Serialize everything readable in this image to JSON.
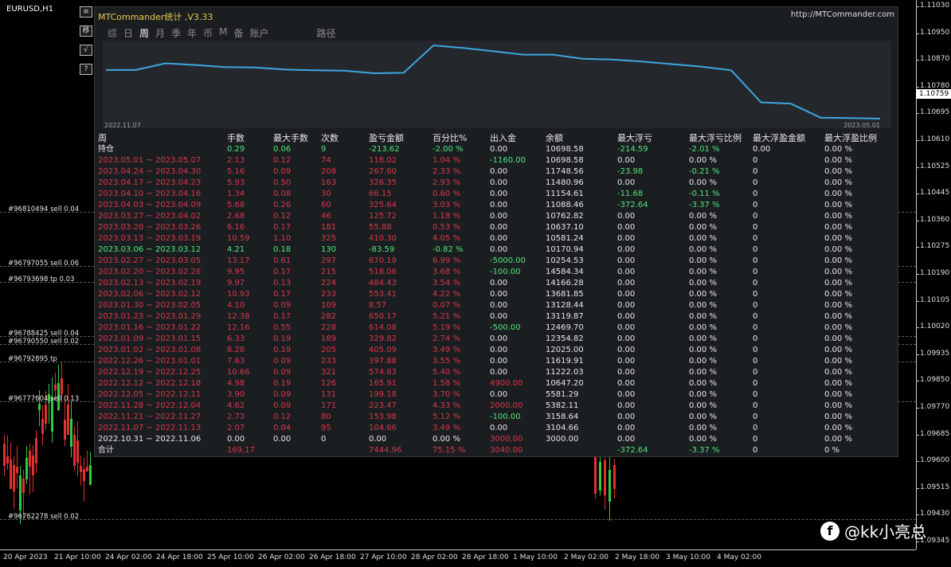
{
  "chart": {
    "title": "EURUSD,H1",
    "price_ticks": [
      "1.11030",
      "1.10950",
      "1.10870",
      "1.10780",
      "1.10695",
      "1.10610",
      "1.10525",
      "1.10445",
      "1.10360",
      "1.10275",
      "1.10190",
      "1.10105",
      "1.10020",
      "1.09935",
      "1.09850",
      "1.09770",
      "1.09685",
      "1.09600",
      "1.09515",
      "1.09430",
      "1.09345"
    ],
    "current_price": "1.10759",
    "time_ticks": [
      "20 Apr 2023",
      "21 Apr 10:00",
      "24 Apr 02:00",
      "24 Apr 18:00",
      "25 Apr 10:00",
      "26 Apr 02:00",
      "26 Apr 18:00",
      "27 Apr 10:00",
      "28 Apr 02:00",
      "28 Apr 18:00",
      "1 May 10:00",
      "2 May 02:00",
      "2 May 18:00",
      "3 May 10:00",
      "4 May 02:00"
    ],
    "order_labels": [
      "#96810494 sell 0.04",
      "#96797055 sell 0.06",
      "#96793698 tp 0.03",
      "#96788425 sell 0.04",
      "#96790550 sell 0.02",
      "#96792895 tp",
      "#96777604 sell 0.13",
      "#96762278 sell 0.02"
    ],
    "side_buttons": [
      "≡",
      "移",
      "√",
      "?"
    ]
  },
  "window": {
    "title": "MTCommander统计 ,V3.33",
    "url": "http://MTCommander.com",
    "tabs": [
      "综",
      "日",
      "周",
      "月",
      "季",
      "年",
      "币",
      "M",
      "备",
      "账户",
      "路径"
    ],
    "active_tab": "周",
    "equity_start": "2022.11.07",
    "equity_end": "2023.05.01",
    "equity_values": [
      3000,
      3104,
      3158,
      5382,
      5581,
      10647,
      11222,
      11620,
      12025,
      12354,
      12470,
      13120,
      13128,
      13682,
      14166,
      14584,
      10254,
      10171,
      10581,
      10637,
      10763,
      11088,
      11155,
      11481,
      11749,
      10699,
      10699
    ]
  },
  "colors": {
    "pos": "#4fe87a",
    "neg": "#d8364a",
    "neutral": "#e6e6e6",
    "accent": "#3ea6e0"
  },
  "table": {
    "headers": [
      "周",
      "手数",
      "最大手数",
      "次数",
      "盈亏金额",
      "百分比%",
      "出入金",
      "余额",
      "最大浮亏",
      "最大浮亏比例",
      "最大浮盈金额",
      "最大浮盈比例"
    ],
    "rows": [
      {
        "c": [
          "持仓",
          "0.29",
          "0.06",
          "9",
          "-213.62",
          "-2.00 %",
          "0.00",
          "10698.58",
          "-214.59",
          "-2.01 %",
          "0.00",
          "0.00 %"
        ],
        "k": [
          "w",
          "g",
          "g",
          "g",
          "g",
          "g",
          "w",
          "w",
          "g",
          "g",
          "w",
          "w"
        ]
      },
      {
        "c": [
          "2023.05.01 ~ 2023.05.07",
          "2.13",
          "0.12",
          "74",
          "118.02",
          "1.04 %",
          "-1160.00",
          "10698.58",
          "0.00",
          "0.00 %",
          "0",
          "0.00 %"
        ],
        "k": [
          "r",
          "r",
          "r",
          "r",
          "r",
          "r",
          "g",
          "w",
          "w",
          "w",
          "w",
          "w"
        ]
      },
      {
        "c": [
          "2023.04.24 ~ 2023.04.30",
          "5.16",
          "0.09",
          "208",
          "267.60",
          "2.33 %",
          "0.00",
          "11748.56",
          "-23.98",
          "-0.21 %",
          "0",
          "0.00 %"
        ],
        "k": [
          "r",
          "r",
          "r",
          "r",
          "r",
          "r",
          "w",
          "w",
          "g",
          "g",
          "w",
          "w"
        ]
      },
      {
        "c": [
          "2023.04.17 ~ 2023.04.23",
          "5.93",
          "0.50",
          "163",
          "326.35",
          "2.93 %",
          "0.00",
          "11480.96",
          "0.00",
          "0.00 %",
          "0",
          "0.00 %"
        ],
        "k": [
          "r",
          "r",
          "r",
          "r",
          "r",
          "r",
          "w",
          "w",
          "w",
          "w",
          "w",
          "w"
        ]
      },
      {
        "c": [
          "2023.04.10 ~ 2023.04.16",
          "1.34",
          "0.08",
          "30",
          "66.15",
          "0.60 %",
          "0.00",
          "11154.61",
          "-11.68",
          "-0.11 %",
          "0",
          "0.00 %"
        ],
        "k": [
          "r",
          "r",
          "r",
          "r",
          "r",
          "r",
          "w",
          "w",
          "g",
          "g",
          "w",
          "w"
        ]
      },
      {
        "c": [
          "2023.04.03 ~ 2023.04.09",
          "5.68",
          "0.26",
          "60",
          "325.64",
          "3.03 %",
          "0.00",
          "11088.46",
          "-372.64",
          "-3.37 %",
          "0",
          "0.00 %"
        ],
        "k": [
          "r",
          "r",
          "r",
          "r",
          "r",
          "r",
          "w",
          "w",
          "g",
          "g",
          "w",
          "w"
        ]
      },
      {
        "c": [
          "2023.03.27 ~ 2023.04.02",
          "2.68",
          "0.12",
          "46",
          "125.72",
          "1.18 %",
          "0.00",
          "10762.82",
          "0.00",
          "0.00 %",
          "0",
          "0.00 %"
        ],
        "k": [
          "r",
          "r",
          "r",
          "r",
          "r",
          "r",
          "w",
          "w",
          "w",
          "w",
          "w",
          "w"
        ]
      },
      {
        "c": [
          "2023.03.20 ~ 2023.03.26",
          "6.16",
          "0.17",
          "181",
          "55.88",
          "0.53 %",
          "0.00",
          "10637.10",
          "0.00",
          "0.00 %",
          "0",
          "0.00 %"
        ],
        "k": [
          "r",
          "r",
          "r",
          "r",
          "r",
          "r",
          "w",
          "w",
          "w",
          "w",
          "w",
          "w"
        ]
      },
      {
        "c": [
          "2023.03.13 ~ 2023.03.19",
          "10.59",
          "1.10",
          "325",
          "410.30",
          "4.05 %",
          "0.00",
          "10581.24",
          "0.00",
          "0.00 %",
          "0",
          "0.00 %"
        ],
        "k": [
          "r",
          "r",
          "r",
          "r",
          "r",
          "r",
          "w",
          "w",
          "w",
          "w",
          "w",
          "w"
        ]
      },
      {
        "c": [
          "2023.03.06 ~ 2023.03.12",
          "4.21",
          "0.18",
          "130",
          "-83.59",
          "-0.82 %",
          "0.00",
          "10170.94",
          "0.00",
          "0.00 %",
          "0",
          "0.00 %"
        ],
        "k": [
          "g",
          "g",
          "g",
          "g",
          "g",
          "g",
          "w",
          "w",
          "w",
          "w",
          "w",
          "w"
        ]
      },
      {
        "c": [
          "2023.02.27 ~ 2023.03.05",
          "13.17",
          "0.61",
          "297",
          "670.19",
          "6.99 %",
          "-5000.00",
          "10254.53",
          "0.00",
          "0.00 %",
          "0",
          "0.00 %"
        ],
        "k": [
          "r",
          "r",
          "r",
          "r",
          "r",
          "r",
          "g",
          "w",
          "w",
          "w",
          "w",
          "w"
        ]
      },
      {
        "c": [
          "2023.02.20 ~ 2023.02.26",
          "9.95",
          "0.17",
          "215",
          "518.06",
          "3.68 %",
          "-100.00",
          "14584.34",
          "0.00",
          "0.00 %",
          "0",
          "0.00 %"
        ],
        "k": [
          "r",
          "r",
          "r",
          "r",
          "r",
          "r",
          "g",
          "w",
          "w",
          "w",
          "w",
          "w"
        ]
      },
      {
        "c": [
          "2023.02.13 ~ 2023.02.19",
          "9.97",
          "0.13",
          "224",
          "484.43",
          "3.54 %",
          "0.00",
          "14166.28",
          "0.00",
          "0.00 %",
          "0",
          "0.00 %"
        ],
        "k": [
          "r",
          "r",
          "r",
          "r",
          "r",
          "r",
          "w",
          "w",
          "w",
          "w",
          "w",
          "w"
        ]
      },
      {
        "c": [
          "2023.02.06 ~ 2023.02.12",
          "10.93",
          "0.17",
          "233",
          "553.41",
          "4.22 %",
          "0.00",
          "13681.85",
          "0.00",
          "0.00 %",
          "0",
          "0.00 %"
        ],
        "k": [
          "r",
          "r",
          "r",
          "r",
          "r",
          "r",
          "w",
          "w",
          "w",
          "w",
          "w",
          "w"
        ]
      },
      {
        "c": [
          "2023.01.30 ~ 2023.02.05",
          "4.10",
          "0.09",
          "109",
          "8.57",
          "0.07 %",
          "0.00",
          "13128.44",
          "0.00",
          "0.00 %",
          "0",
          "0.00 %"
        ],
        "k": [
          "r",
          "r",
          "r",
          "r",
          "r",
          "r",
          "w",
          "w",
          "w",
          "w",
          "w",
          "w"
        ]
      },
      {
        "c": [
          "2023.01.23 ~ 2023.01.29",
          "12.38",
          "0.17",
          "282",
          "650.17",
          "5.21 %",
          "0.00",
          "13119.87",
          "0.00",
          "0.00 %",
          "0",
          "0.00 %"
        ],
        "k": [
          "r",
          "r",
          "r",
          "r",
          "r",
          "r",
          "w",
          "w",
          "w",
          "w",
          "w",
          "w"
        ]
      },
      {
        "c": [
          "2023.01.16 ~ 2023.01.22",
          "12.16",
          "0.55",
          "228",
          "614.08",
          "5.19 %",
          "-500.00",
          "12469.70",
          "0.00",
          "0.00 %",
          "0",
          "0.00 %"
        ],
        "k": [
          "r",
          "r",
          "r",
          "r",
          "r",
          "r",
          "g",
          "w",
          "w",
          "w",
          "w",
          "w"
        ]
      },
      {
        "c": [
          "2023.01.09 ~ 2023.01.15",
          "6.33",
          "0.19",
          "189",
          "329.82",
          "2.74 %",
          "0.00",
          "12354.82",
          "0.00",
          "0.00 %",
          "0",
          "0.00 %"
        ],
        "k": [
          "r",
          "r",
          "r",
          "r",
          "r",
          "r",
          "w",
          "w",
          "w",
          "w",
          "w",
          "w"
        ]
      },
      {
        "c": [
          "2023.01.02 ~ 2023.01.08",
          "8.28",
          "0.19",
          "205",
          "405.09",
          "3.49 %",
          "0.00",
          "12025.00",
          "0.00",
          "0.00 %",
          "0",
          "0.00 %"
        ],
        "k": [
          "r",
          "r",
          "r",
          "r",
          "r",
          "r",
          "w",
          "w",
          "w",
          "w",
          "w",
          "w"
        ]
      },
      {
        "c": [
          "2022.12.26 ~ 2023.01.01",
          "7.63",
          "0.09",
          "233",
          "397.88",
          "3.55 %",
          "0.00",
          "11619.91",
          "0.00",
          "0.00 %",
          "0",
          "0.00 %"
        ],
        "k": [
          "r",
          "r",
          "r",
          "r",
          "r",
          "r",
          "w",
          "w",
          "w",
          "w",
          "w",
          "w"
        ]
      },
      {
        "c": [
          "2022.12.19 ~ 2022.12.25",
          "10.66",
          "0.09",
          "321",
          "574.83",
          "5.40 %",
          "0.00",
          "11222.03",
          "0.00",
          "0.00 %",
          "0",
          "0.00 %"
        ],
        "k": [
          "r",
          "r",
          "r",
          "r",
          "r",
          "r",
          "w",
          "w",
          "w",
          "w",
          "w",
          "w"
        ]
      },
      {
        "c": [
          "2022.12.12 ~ 2022.12.18",
          "4.98",
          "0.19",
          "126",
          "165.91",
          "1.58 %",
          "4900.00",
          "10647.20",
          "0.00",
          "0.00 %",
          "0",
          "0.00 %"
        ],
        "k": [
          "r",
          "r",
          "r",
          "r",
          "r",
          "r",
          "r",
          "w",
          "w",
          "w",
          "w",
          "w"
        ]
      },
      {
        "c": [
          "2022.12.05 ~ 2022.12.11",
          "3.90",
          "0.09",
          "131",
          "199.18",
          "3.70 %",
          "0.00",
          "5581.29",
          "0.00",
          "0.00 %",
          "0",
          "0.00 %"
        ],
        "k": [
          "r",
          "r",
          "r",
          "r",
          "r",
          "r",
          "w",
          "w",
          "w",
          "w",
          "w",
          "w"
        ]
      },
      {
        "c": [
          "2022.11.28 ~ 2022.12.04",
          "4.62",
          "0.09",
          "171",
          "223.47",
          "4.33 %",
          "2000.00",
          "5382.11",
          "0.00",
          "0.00 %",
          "0",
          "0.00 %"
        ],
        "k": [
          "r",
          "r",
          "r",
          "r",
          "r",
          "r",
          "r",
          "w",
          "w",
          "w",
          "w",
          "w"
        ]
      },
      {
        "c": [
          "2022.11.21 ~ 2022.11.27",
          "2.73",
          "0.12",
          "80",
          "153.98",
          "5.12 %",
          "-100.00",
          "3158.64",
          "0.00",
          "0.00 %",
          "0",
          "0.00 %"
        ],
        "k": [
          "r",
          "r",
          "r",
          "r",
          "r",
          "r",
          "g",
          "w",
          "w",
          "w",
          "w",
          "w"
        ]
      },
      {
        "c": [
          "2022.11.07 ~ 2022.11.13",
          "2.07",
          "0.04",
          "95",
          "104.66",
          "3.49 %",
          "0.00",
          "3104.66",
          "0.00",
          "0.00 %",
          "0",
          "0.00 %"
        ],
        "k": [
          "r",
          "r",
          "r",
          "r",
          "r",
          "r",
          "w",
          "w",
          "w",
          "w",
          "w",
          "w"
        ]
      },
      {
        "c": [
          "2022.10.31 ~ 2022.11.06",
          "0.00",
          "0.00",
          "0",
          "0.00",
          "0.00 %",
          "3000.00",
          "3000.00",
          "0.00",
          "0.00 %",
          "0",
          "0.00 %"
        ],
        "k": [
          "w",
          "w",
          "w",
          "w",
          "w",
          "w",
          "r",
          "w",
          "w",
          "w",
          "w",
          "w"
        ]
      }
    ],
    "total": {
      "c": [
        "合计",
        "169.17",
        "",
        "",
        "7444.96",
        "75.15 %",
        "3040.00",
        "",
        "-372.64",
        "-3.37 %",
        "0",
        "0 %"
      ],
      "k": [
        "w",
        "r",
        "w",
        "w",
        "r",
        "r",
        "r",
        "w",
        "g",
        "g",
        "w",
        "w"
      ]
    }
  },
  "watermark": {
    "logo": "f",
    "text": "@kk小亮总"
  }
}
